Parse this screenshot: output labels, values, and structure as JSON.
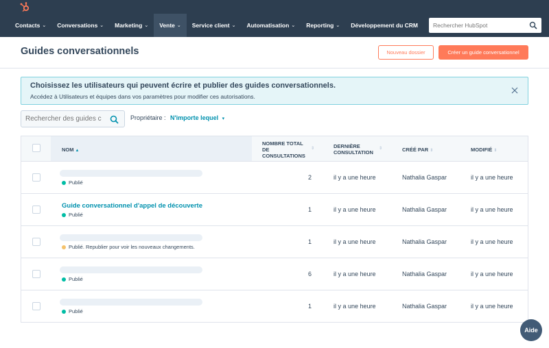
{
  "nav": {
    "items": [
      {
        "label": "Contacts",
        "chevron": true,
        "active": false
      },
      {
        "label": "Conversations",
        "chevron": true,
        "active": false
      },
      {
        "label": "Marketing",
        "chevron": true,
        "active": false
      },
      {
        "label": "Vente",
        "chevron": true,
        "active": true
      },
      {
        "label": "Service client",
        "chevron": true,
        "active": false
      },
      {
        "label": "Automatisation",
        "chevron": true,
        "active": false
      },
      {
        "label": "Reporting",
        "chevron": true,
        "active": false
      },
      {
        "label": "Développement du CRM",
        "chevron": false,
        "active": false
      }
    ],
    "search_placeholder": "Rechercher HubSpot",
    "chevron_glyph": "⌄"
  },
  "header": {
    "title": "Guides conversationnels",
    "secondary_button": "Nouveau dossier",
    "primary_button": "Créer un guide conversationnel"
  },
  "alert": {
    "title": "Choisissez les utilisateurs qui peuvent écrire et publier des guides conversationnels.",
    "text": "Accédez à Utilisateurs et équipes dans vos paramètres pour modifier ces autorisations."
  },
  "filters": {
    "search_placeholder": "Rechercher des guides c",
    "owner_label": "Propriétaire :",
    "owner_value": "N'importe lequel"
  },
  "table": {
    "columns": {
      "name": "Nom",
      "views_line1": "Nombre total",
      "views_line2": "de",
      "views_line3": "consultations",
      "last_view_line1": "Dernière",
      "last_view_line2": "consultation",
      "created_by": "Créé par",
      "modified": "Modifié"
    },
    "rows": [
      {
        "title": "",
        "status": "Publié",
        "status_color": "#00bda5",
        "views": "2",
        "last_view": "il y a une heure",
        "created_by": "Nathalia Gaspar",
        "modified": "il y a une heure"
      },
      {
        "title": "Guide conversationnel d'appel de découverte",
        "status": "Publié",
        "status_color": "#00bda5",
        "views": "1",
        "last_view": "il y a une heure",
        "created_by": "Nathalia Gaspar",
        "modified": "il y a une heure"
      },
      {
        "title": "",
        "status": "Publié. Republier pour voir les nouveaux changements.",
        "status_color": "#f5c26b",
        "views": "1",
        "last_view": "il y a une heure",
        "created_by": "Nathalia Gaspar",
        "modified": "il y a une heure"
      },
      {
        "title": "",
        "status": "Publié",
        "status_color": "#00bda5",
        "views": "6",
        "last_view": "il y a une heure",
        "created_by": "Nathalia Gaspar",
        "modified": "il y a une heure"
      },
      {
        "title": "",
        "status": "Publié",
        "status_color": "#00bda5",
        "views": "1",
        "last_view": "il y a une heure",
        "created_by": "Nathalia Gaspar",
        "modified": "il y a une heure"
      }
    ]
  },
  "help": {
    "label": "Aide"
  },
  "colors": {
    "brand": "#ff7a59",
    "nav": "#2d3e50",
    "link": "#0091ae",
    "published": "#00bda5",
    "warning": "#f5c26b"
  }
}
